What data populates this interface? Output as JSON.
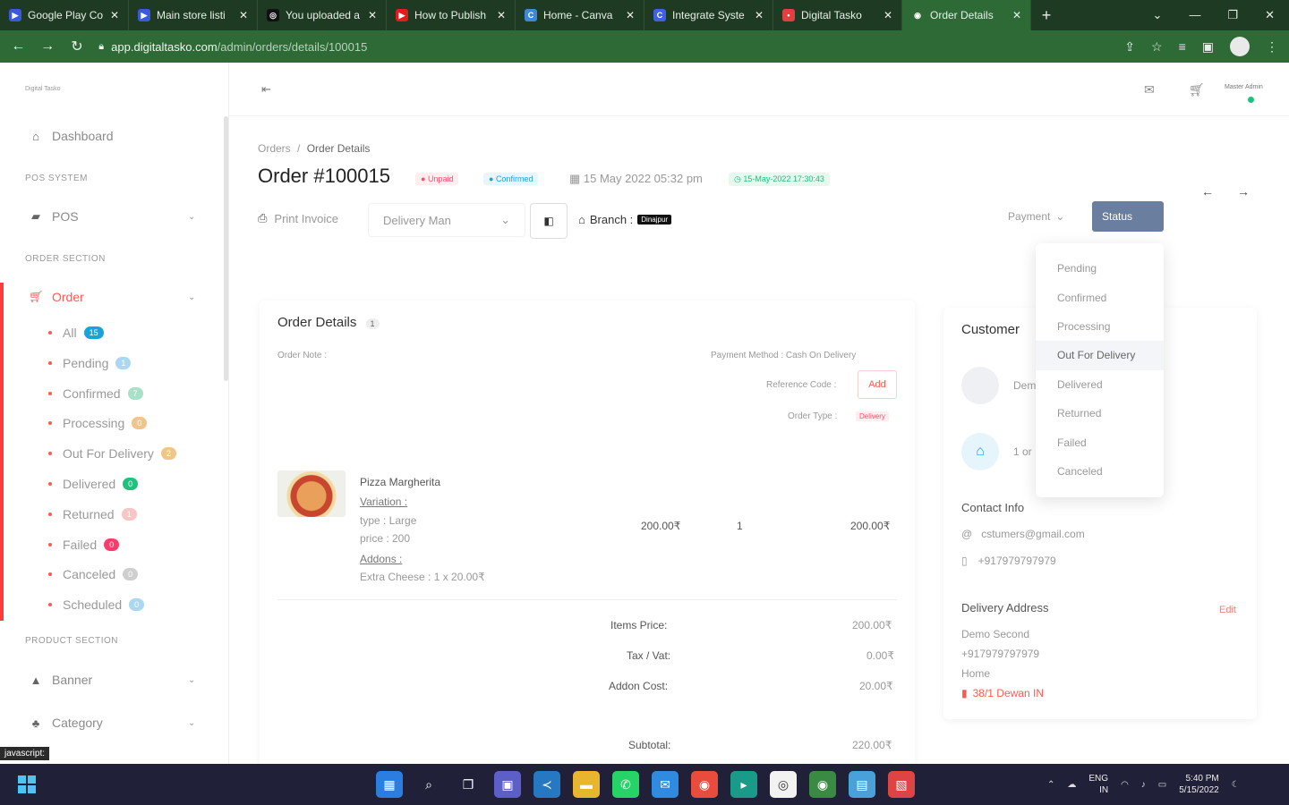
{
  "browser": {
    "tabs": [
      {
        "label": "Google Play Co",
        "color": "#3a5bd9",
        "glyph": "▶",
        "active": false
      },
      {
        "label": "Main store listi",
        "color": "#3a5bd9",
        "glyph": "▶",
        "active": false
      },
      {
        "label": "You uploaded a",
        "color": "#111111",
        "glyph": "◎",
        "active": false
      },
      {
        "label": "How to Publish",
        "color": "#e21b1b",
        "glyph": "▶",
        "active": false
      },
      {
        "label": "Home - Canva",
        "color": "#3b8ad9",
        "glyph": "C",
        "active": false
      },
      {
        "label": "Integrate Syste",
        "color": "#4062e0",
        "glyph": "C",
        "active": false
      },
      {
        "label": "Digital Tasko",
        "color": "#e04040",
        "glyph": "•",
        "active": false
      },
      {
        "label": "Order Details",
        "color": "#ffffff",
        "glyph": "◉",
        "active": true
      }
    ],
    "new_tab": "+",
    "url_host": "app.digitaltasko.com",
    "url_path": "/admin/orders/details/100015"
  },
  "sidebar": {
    "logo_text": "Digital Tasko",
    "dashboard": "Dashboard",
    "sec_pos": "POS SYSTEM",
    "pos": "POS",
    "sec_order": "ORDER SECTION",
    "order": "Order",
    "sub": [
      {
        "label": "All",
        "count": "15",
        "color": "#1aa3d9"
      },
      {
        "label": "Pending",
        "count": "1",
        "color": "#a9d8f0"
      },
      {
        "label": "Confirmed",
        "count": "7",
        "color": "#a8e0c8"
      },
      {
        "label": "Processing",
        "count": "0",
        "color": "#f0c48a"
      },
      {
        "label": "Out For Delivery",
        "count": "2",
        "color": "#f0c48a"
      },
      {
        "label": "Delivered",
        "count": "0",
        "color": "#21c07c"
      },
      {
        "label": "Returned",
        "count": "1",
        "color": "#f8c4c4"
      },
      {
        "label": "Failed",
        "count": "0",
        "color": "#ff3b6b"
      },
      {
        "label": "Canceled",
        "count": "0",
        "color": "#cfcfcf"
      },
      {
        "label": "Scheduled",
        "count": "0",
        "color": "#a9d8f0"
      }
    ],
    "sec_product": "PRODUCT SECTION",
    "banner": "Banner",
    "category": "Category"
  },
  "topbar": {
    "admin_label": "Master Admin"
  },
  "page": {
    "breadcrumb_root": "Orders",
    "breadcrumb_sep": "/",
    "breadcrumb_current": "Order Details",
    "title": "Order #100015",
    "chip_unpaid": "Unpaid",
    "chip_confirmed": "Confirmed",
    "date": "15 May 2022 05:32 pm",
    "schedule_chip": "15-May-2022 17:30:43",
    "print_invoice": "Print Invoice",
    "delivery_man": "Delivery Man",
    "branch_label": "Branch :",
    "branch_tag": "Dinajpur",
    "payment": "Payment",
    "status": "Status"
  },
  "status_menu": [
    "Pending",
    "Confirmed",
    "Processing",
    "Out For Delivery",
    "Delivered",
    "Returned",
    "Failed",
    "Canceled"
  ],
  "order_details": {
    "title": "Order Details",
    "count": "1",
    "order_note": "Order Note :",
    "payment_method": "Payment Method : Cash On Delivery",
    "reference_label": "Reference Code :",
    "reference_add": "Add",
    "order_type_label": "Order Type :",
    "order_type_value": "Delivery",
    "item_name": "Pizza Margherita",
    "variation_label": "Variation :",
    "type_line": "type : Large",
    "price_line": "price : 200",
    "addons_label": "Addons :",
    "addon_line": "Extra Cheese : 1 x 20.00₹",
    "unit_price": "200.00₹",
    "qty": "1",
    "line_total": "200.00₹",
    "items_price_label": "Items Price:",
    "items_price": "200.00₹",
    "tax_label": "Tax / Vat:",
    "tax": "0.00₹",
    "addon_cost_label": "Addon Cost:",
    "addon_cost": "20.00₹",
    "subtotal_label": "Subtotal:",
    "subtotal": "220.00₹"
  },
  "customer": {
    "title": "Customer",
    "name_partial": "Dem",
    "orders_partial": "1 or",
    "contact_title": "Contact Info",
    "email": "cstumers@gmail.com",
    "phone": "+917979797979",
    "delivery_title": "Delivery Address",
    "edit": "Edit",
    "addr_name": "Demo Second",
    "addr_phone": "+917979797979",
    "addr_type": "Home",
    "addr_line": "38/1 Dewan IN"
  },
  "status_bar": {
    "tooltip": "javascript:"
  },
  "taskbar": {
    "lang": "ENG",
    "region": "IN",
    "time": "5:40 PM",
    "date": "5/15/2022"
  },
  "colors": {
    "accent_red": "#ff3b3b",
    "chrome_green": "#2d6a35",
    "status_button": "#6a7ea0"
  }
}
